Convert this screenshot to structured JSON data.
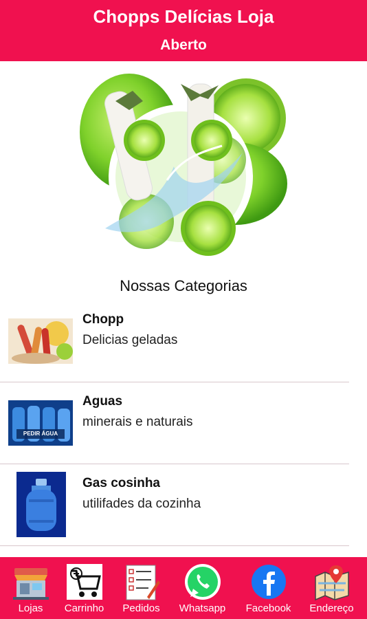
{
  "header": {
    "title": "Chopps Delícias Loja",
    "status": "Aberto"
  },
  "section_title": "Nossas Categorias",
  "categories": [
    {
      "name": "Chopp",
      "description": "Delicias geladas",
      "thumbnail_icon": "chopp-thumbnail"
    },
    {
      "name": "Aguas",
      "description": "minerais e naturais",
      "thumbnail_icon": "water-bottles-thumbnail",
      "thumbnail_text": "PEDIR ÁGUA"
    },
    {
      "name": "Gas cosinha",
      "description": "utilifades da cozinha",
      "thumbnail_icon": "gas-cylinder-thumbnail"
    }
  ],
  "nav": [
    {
      "label": "Lojas",
      "icon": "store-icon"
    },
    {
      "label": "Carrinho",
      "icon": "cart-icon"
    },
    {
      "label": "Pedidos",
      "icon": "orders-icon"
    },
    {
      "label": "Whatsapp",
      "icon": "whatsapp-icon"
    },
    {
      "label": "Facebook",
      "icon": "facebook-icon"
    },
    {
      "label": "Endereço",
      "icon": "map-icon"
    }
  ],
  "colors": {
    "primary": "#f0114f",
    "lime": "#7ccb2a",
    "whatsapp": "#25d366",
    "facebook": "#1877f2"
  }
}
